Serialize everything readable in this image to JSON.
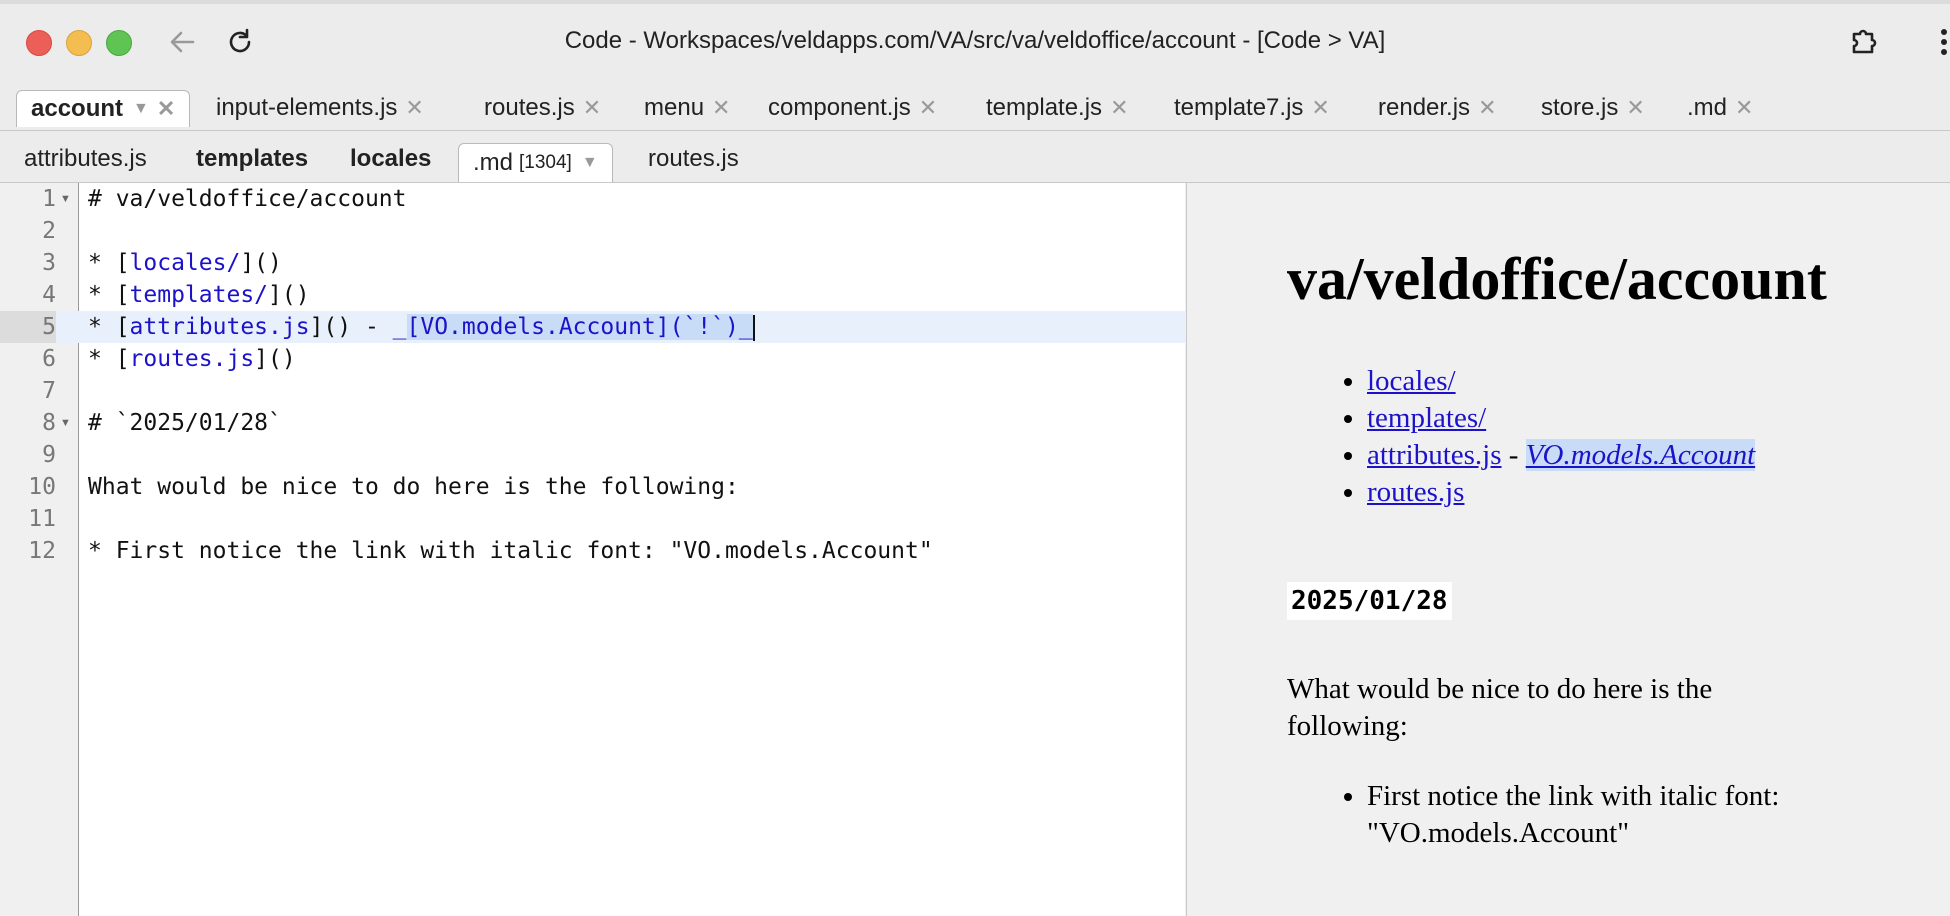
{
  "window": {
    "title": "Code - Workspaces/veldapps.com/VA/src/va/veldoffice/account - [Code > VA]"
  },
  "tabs_primary": [
    {
      "label": "account",
      "active": true
    },
    {
      "label": "input-elements.js"
    },
    {
      "label": "routes.js"
    },
    {
      "label": "menu"
    },
    {
      "label": "component.js"
    },
    {
      "label": "template.js"
    },
    {
      "label": "template7.js"
    },
    {
      "label": "render.js"
    },
    {
      "label": "store.js"
    },
    {
      "label": ".md"
    }
  ],
  "tabs_secondary": [
    {
      "label": "attributes.js"
    },
    {
      "label": "templates",
      "bold": true
    },
    {
      "label": "locales",
      "bold": true
    },
    {
      "label": ".md",
      "size": "[1304]",
      "active": true
    },
    {
      "label": "routes.js"
    }
  ],
  "editor": {
    "lines": [
      {
        "n": "1",
        "text": "# va/veldoffice/account"
      },
      {
        "n": "2",
        "text": ""
      },
      {
        "n": "3",
        "pre": "* [",
        "link": "locales/",
        "post": "]()"
      },
      {
        "n": "4",
        "pre": "* [",
        "link": "templates/",
        "post": "]()"
      },
      {
        "n": "5",
        "pre": "* [",
        "link": "attributes.js",
        "post": "]() - ",
        "sel_a": "_",
        "sel_b": "[VO.models.Account](`!`)_"
      },
      {
        "n": "6",
        "pre": "* [",
        "link": "routes.js",
        "post": "]()"
      },
      {
        "n": "7",
        "text": ""
      },
      {
        "n": "8",
        "text": "# `2025/01/28`"
      },
      {
        "n": "9",
        "text": ""
      },
      {
        "n": "10",
        "text": "What would be nice to do here is the following:"
      },
      {
        "n": "11",
        "text": ""
      },
      {
        "n": "12",
        "text": "* First notice the link with italic font: \"VO.models.Account\""
      }
    ]
  },
  "preview": {
    "title": "va/veldoffice/account",
    "links": [
      "locales/",
      "templates/",
      "attributes.js",
      "routes.js"
    ],
    "attr_sep": " - ",
    "attr_italic_link": "VO.models.Account",
    "date_code": "2025/01/28",
    "paragraph": "What would be nice to do here is the following:",
    "bullet": "First notice the link with italic font: \"VO.models.Account\""
  },
  "colors": {
    "link": "#1c12c9",
    "selection": "#c8dcf7",
    "current_line": "#e8f0fb"
  },
  "icons": [
    "back-arrow-icon",
    "reload-icon",
    "extension-icon",
    "more-vert-icon",
    "close-icon",
    "chevron-down-icon",
    "fold-arrow-icon"
  ]
}
